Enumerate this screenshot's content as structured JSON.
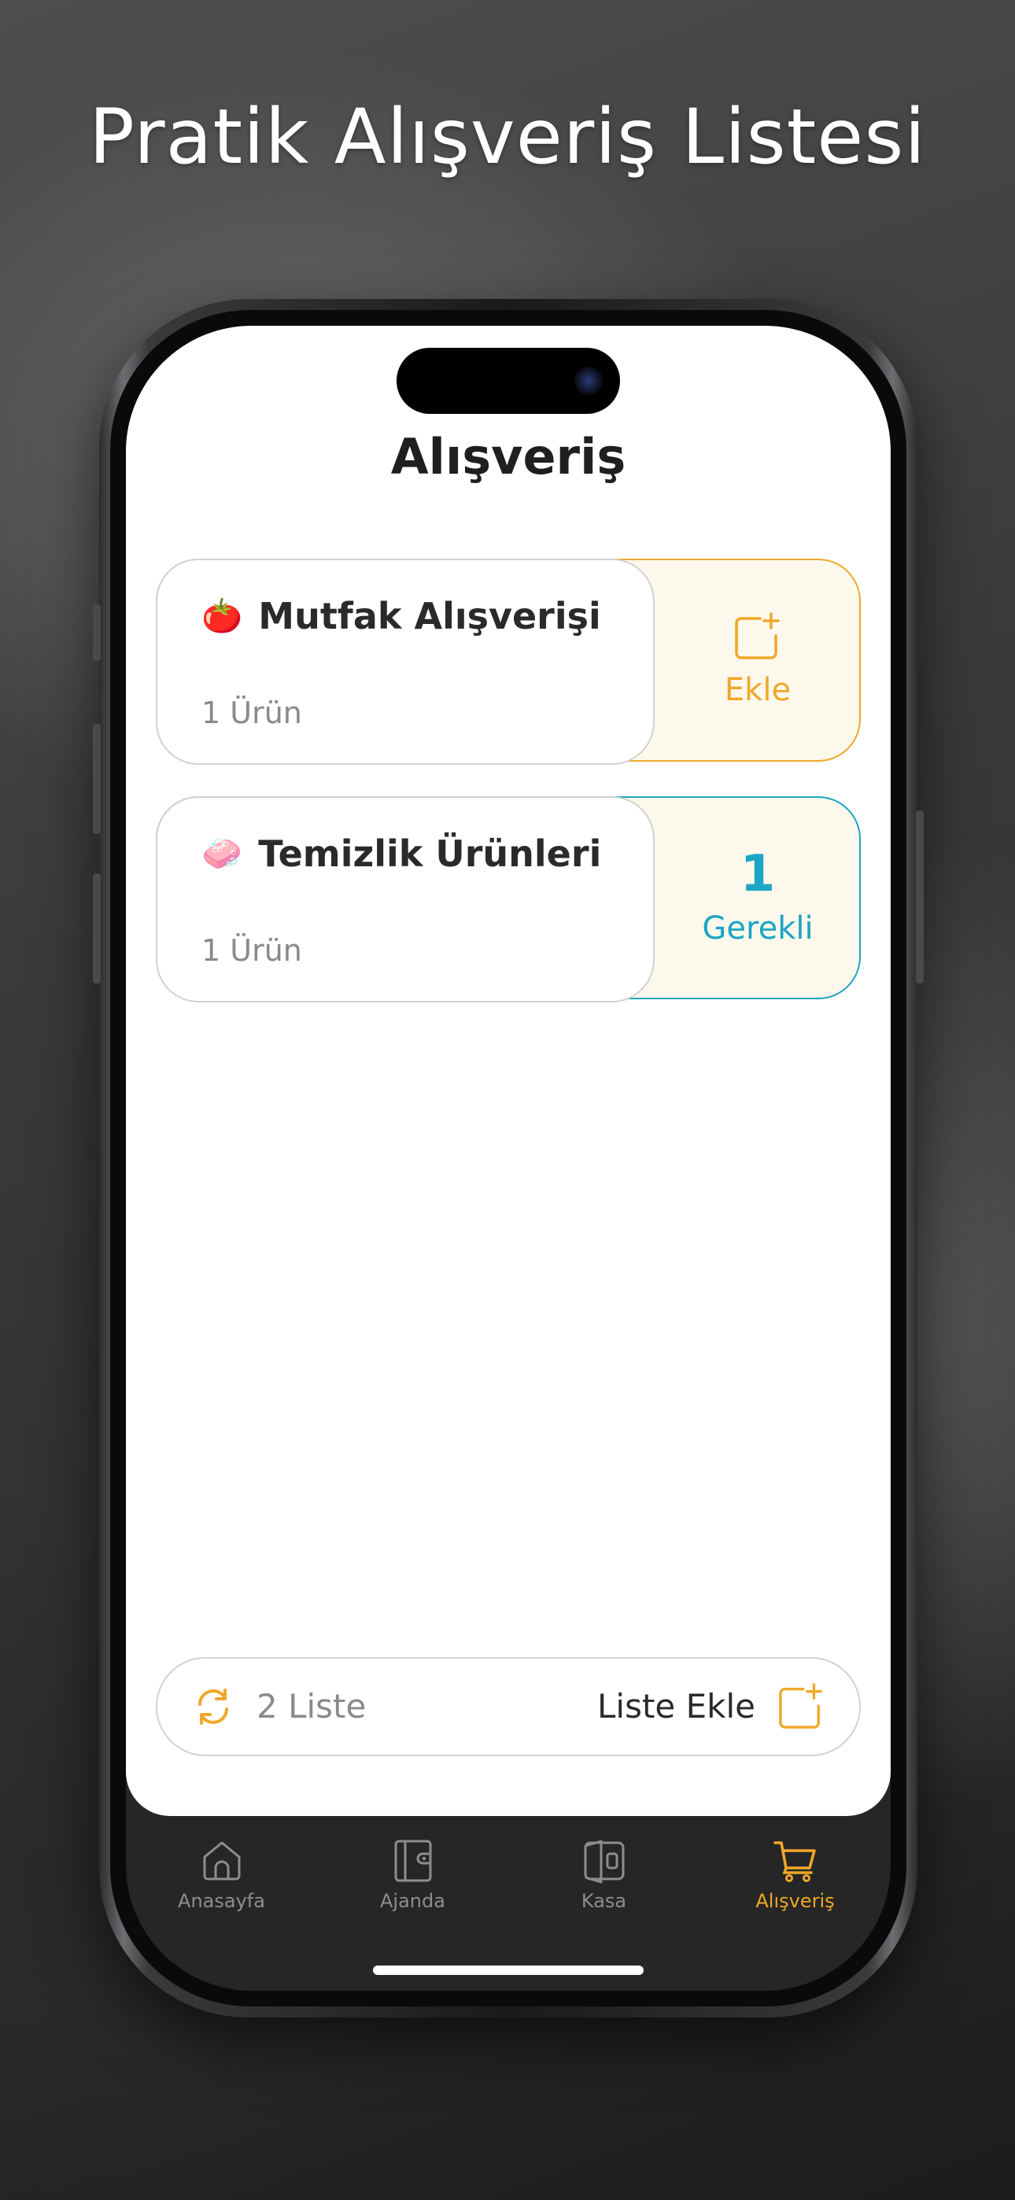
{
  "headline": "Pratik Alışveriş Listesi",
  "page_title": "Alışveriş",
  "lists": [
    {
      "emoji": "🍅",
      "name": "Mutfak Alışverişi",
      "count_label": "1 Ürün",
      "action": {
        "type": "add",
        "label": "Ekle",
        "icon": "add-square-icon",
        "color": "#f0a82a"
      }
    },
    {
      "emoji": "🧼",
      "name": "Temizlik Ürünleri",
      "count_label": "1 Ürün",
      "action": {
        "type": "required",
        "number": "1",
        "label": "Gerekli",
        "color": "#1aa6c4"
      }
    }
  ],
  "footer": {
    "refresh_icon": "refresh-icon",
    "list_count_label": "2 Liste",
    "add_list_label": "Liste Ekle",
    "add_icon": "add-square-icon"
  },
  "tabbar": {
    "items": [
      {
        "label": "Anasayfa",
        "icon": "home-icon",
        "active": false
      },
      {
        "label": "Ajanda",
        "icon": "wallet-icon",
        "active": false
      },
      {
        "label": "Kasa",
        "icon": "safe-icon",
        "active": false
      },
      {
        "label": "Alışveriş",
        "icon": "cart-icon",
        "active": true
      }
    ]
  },
  "colors": {
    "accent": "#f0a82a",
    "teal": "#1aa6c4",
    "tabbar_bg": "#262626"
  }
}
